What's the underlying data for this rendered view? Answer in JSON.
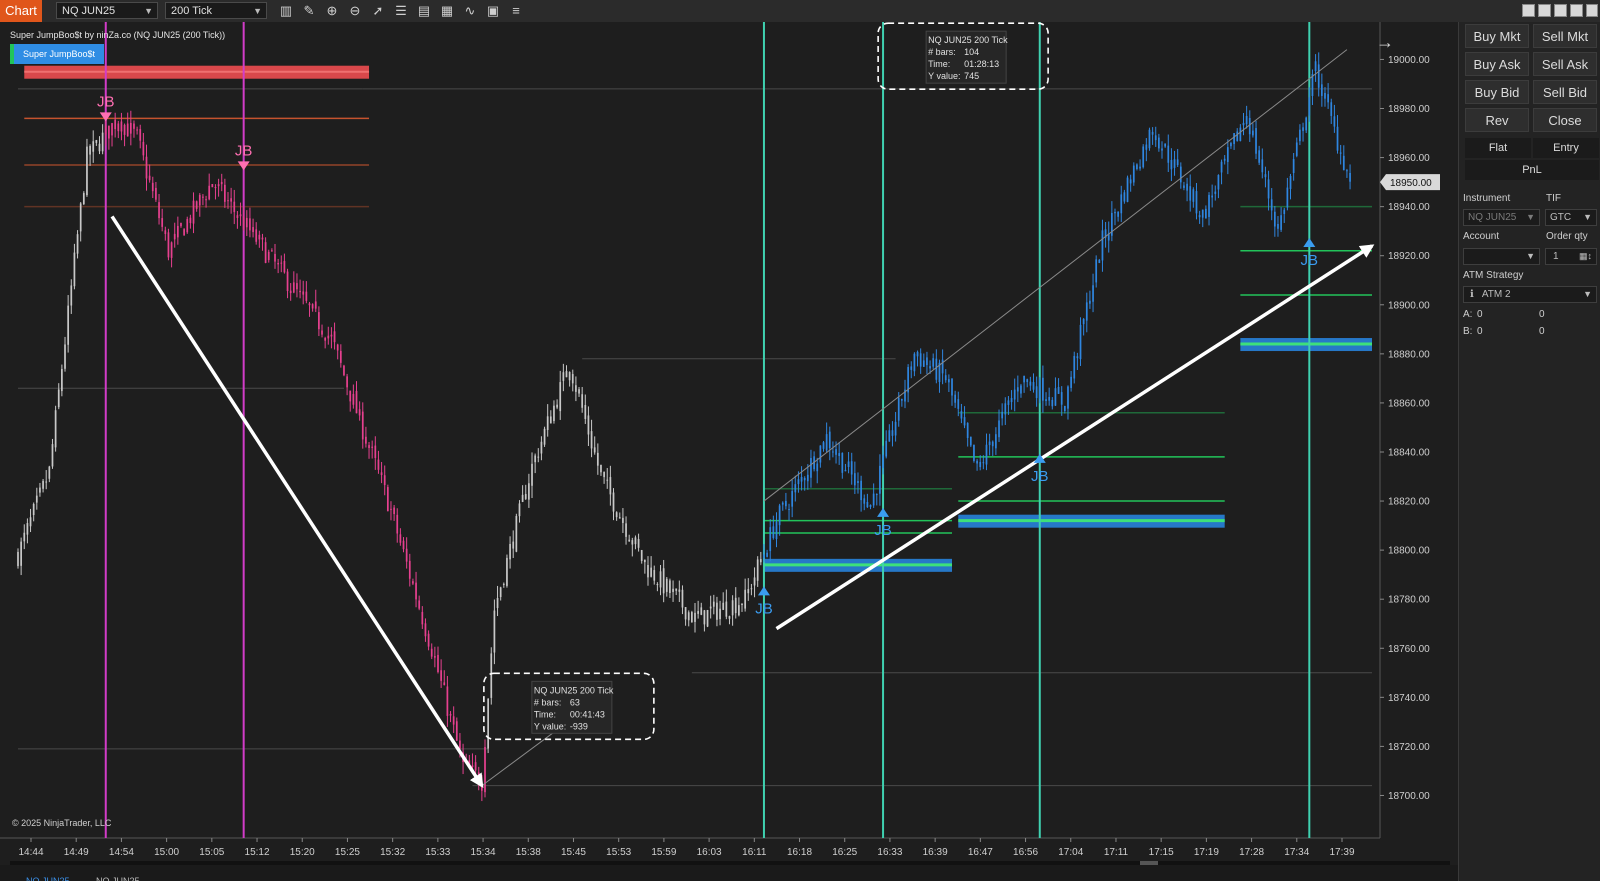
{
  "toolbar": {
    "chart_label": "Chart",
    "instrument": "NQ JUN25",
    "interval": "200 Tick",
    "icons": [
      "bar-type-icon",
      "pencil-icon",
      "zoom-in-icon",
      "zoom-out-icon",
      "pointer-icon",
      "properties-icon",
      "data-box-icon",
      "strategies-icon",
      "indicators-icon",
      "templates-icon",
      "list-icon"
    ]
  },
  "legend": {
    "title": "Super JumpBoo$t by ninZa.co (NQ JUN25 (200 Tick))",
    "button": "Super JumpBoo$t"
  },
  "copyright": "© 2025 NinjaTrader, LLC",
  "last_price_label": "18950.00",
  "chart_data": {
    "type": "candlestick",
    "ylim": [
      18690,
      19012
    ],
    "y_ticks": [
      18700,
      18720,
      18740,
      18760,
      18780,
      18800,
      18820,
      18840,
      18860,
      18880,
      18900,
      18920,
      18940,
      18960,
      18980,
      19000
    ],
    "x_ticks": [
      "14:44",
      "14:49",
      "14:54",
      "15:00",
      "15:05",
      "15:12",
      "15:20",
      "15:25",
      "15:32",
      "15:33",
      "15:34",
      "15:38",
      "15:45",
      "15:53",
      "15:59",
      "16:03",
      "16:11",
      "16:18",
      "16:25",
      "16:33",
      "16:39",
      "16:47",
      "16:56",
      "17:04",
      "17:11",
      "17:15",
      "17:19",
      "17:28",
      "17:34",
      "17:39"
    ],
    "price_path": [
      {
        "bar": 0,
        "price": 18798
      },
      {
        "bar": 10,
        "price": 18832
      },
      {
        "bar": 22,
        "price": 18960
      },
      {
        "bar": 32,
        "price": 18976
      },
      {
        "bar": 38,
        "price": 18968
      },
      {
        "bar": 48,
        "price": 18922
      },
      {
        "bar": 62,
        "price": 18950
      },
      {
        "bar": 74,
        "price": 18930
      },
      {
        "bar": 100,
        "price": 18886
      },
      {
        "bar": 118,
        "price": 18820
      },
      {
        "bar": 132,
        "price": 18760
      },
      {
        "bar": 142,
        "price": 18712
      },
      {
        "bar": 148,
        "price": 18706
      },
      {
        "bar": 152,
        "price": 18776
      },
      {
        "bar": 164,
        "price": 18834
      },
      {
        "bar": 176,
        "price": 18876
      },
      {
        "bar": 186,
        "price": 18830
      },
      {
        "bar": 200,
        "price": 18794
      },
      {
        "bar": 216,
        "price": 18772
      },
      {
        "bar": 232,
        "price": 18780
      },
      {
        "bar": 242,
        "price": 18812
      },
      {
        "bar": 258,
        "price": 18846
      },
      {
        "bar": 272,
        "price": 18818
      },
      {
        "bar": 286,
        "price": 18880
      },
      {
        "bar": 296,
        "price": 18870
      },
      {
        "bar": 306,
        "price": 18832
      },
      {
        "bar": 320,
        "price": 18870
      },
      {
        "bar": 334,
        "price": 18860
      },
      {
        "bar": 346,
        "price": 18926
      },
      {
        "bar": 362,
        "price": 18972
      },
      {
        "bar": 378,
        "price": 18936
      },
      {
        "bar": 392,
        "price": 18978
      },
      {
        "bar": 402,
        "price": 18930
      },
      {
        "bar": 414,
        "price": 18996
      },
      {
        "bar": 425,
        "price": 18950
      }
    ],
    "segments": [
      {
        "from_bar": 0,
        "to_bar": 28,
        "color": "white"
      },
      {
        "from_bar": 28,
        "to_bar": 150,
        "color": "pink"
      },
      {
        "from_bar": 150,
        "to_bar": 238,
        "color": "white"
      },
      {
        "from_bar": 238,
        "to_bar": 425,
        "color": "blue"
      }
    ],
    "jb_signals": [
      {
        "bar": 28,
        "price": 18976,
        "direction": "down",
        "label": "JB"
      },
      {
        "bar": 72,
        "price": 18956,
        "direction": "down",
        "label": "JB"
      },
      {
        "bar": 238,
        "price": 18784,
        "direction": "up",
        "label": "JB"
      },
      {
        "bar": 276,
        "price": 18816,
        "direction": "up",
        "label": "JB"
      },
      {
        "bar": 326,
        "price": 18838,
        "direction": "up",
        "label": "JB"
      },
      {
        "bar": 412,
        "price": 18926,
        "direction": "up",
        "label": "JB"
      }
    ],
    "signal_verticals": [
      {
        "bar": 28,
        "color": "magenta"
      },
      {
        "bar": 72,
        "color": "magenta"
      },
      {
        "bar": 238,
        "color": "teal"
      },
      {
        "bar": 276,
        "color": "teal"
      },
      {
        "bar": 326,
        "color": "teal"
      },
      {
        "bar": 412,
        "color": "teal"
      }
    ],
    "zones": [
      {
        "from_bar": 2,
        "to_bar": 112,
        "price": 18995,
        "style": "red-band"
      },
      {
        "from_bar": 2,
        "to_bar": 112,
        "price": 18976,
        "style": "orange-line"
      },
      {
        "from_bar": 2,
        "to_bar": 112,
        "price": 18957,
        "style": "orange-line-dim"
      },
      {
        "from_bar": 2,
        "to_bar": 112,
        "price": 18940,
        "style": "orange-line-faint"
      },
      {
        "from_bar": 238,
        "to_bar": 298,
        "price": 18794,
        "style": "blue-green-band"
      },
      {
        "from_bar": 238,
        "to_bar": 298,
        "price": 18807,
        "style": "green-line"
      },
      {
        "from_bar": 238,
        "to_bar": 298,
        "price": 18812,
        "style": "green-line"
      },
      {
        "from_bar": 238,
        "to_bar": 298,
        "price": 18825,
        "style": "green-line-faint"
      },
      {
        "from_bar": 300,
        "to_bar": 385,
        "price": 18812,
        "style": "blue-green-band"
      },
      {
        "from_bar": 300,
        "to_bar": 385,
        "price": 18820,
        "style": "green-line"
      },
      {
        "from_bar": 300,
        "to_bar": 385,
        "price": 18838,
        "style": "green-line"
      },
      {
        "from_bar": 300,
        "to_bar": 385,
        "price": 18856,
        "style": "green-line-faint"
      },
      {
        "from_bar": 390,
        "to_bar": 432,
        "price": 18884,
        "style": "blue-green-band"
      },
      {
        "from_bar": 390,
        "to_bar": 432,
        "price": 18904,
        "style": "green-line"
      },
      {
        "from_bar": 390,
        "to_bar": 432,
        "price": 18922,
        "style": "green-line"
      },
      {
        "from_bar": 390,
        "to_bar": 432,
        "price": 18940,
        "style": "green-line-faint"
      }
    ],
    "gray_levels": [
      {
        "from_bar": 0,
        "to_bar": 110,
        "price": 18988
      },
      {
        "from_bar": 0,
        "to_bar": 104,
        "price": 18866
      },
      {
        "from_bar": 180,
        "to_bar": 280,
        "price": 18878
      },
      {
        "from_bar": 215,
        "to_bar": 432,
        "price": 18750
      },
      {
        "from_bar": 0,
        "to_bar": 150,
        "price": 18719
      },
      {
        "from_bar": 145,
        "to_bar": 432,
        "price": 18704
      },
      {
        "from_bar": 110,
        "to_bar": 432,
        "price": 18988
      }
    ],
    "trend_arrows": [
      {
        "from_bar": 30,
        "from_price": 18936,
        "to_bar": 148,
        "to_price": 18704
      },
      {
        "from_bar": 242,
        "from_price": 18768,
        "to_bar": 432,
        "to_price": 18924
      }
    ],
    "measure_lines": [
      {
        "from_bar": 148,
        "from_price": 18704,
        "to_bar": 186,
        "to_price": 18740
      },
      {
        "from_bar": 238,
        "from_price": 18820,
        "to_bar": 424,
        "to_price": 19004
      }
    ],
    "measure_boxes": [
      {
        "title": "NQ JUN25 200 Tick",
        "bars_label": "# bars:",
        "bars": "63",
        "time_label": "Time:",
        "time": "00:41:43",
        "yval_label": "Y value:",
        "yval": "-939",
        "anchor_bar": 148,
        "anchor_price": 18740
      },
      {
        "title": "NQ JUN25 200 Tick",
        "bars_label": "# bars:",
        "bars": "104",
        "time_label": "Time:",
        "time": "01:28:13",
        "yval_label": "Y value:",
        "yval": "745",
        "anchor_bar": 284,
        "anchor_price": 19005
      }
    ],
    "colors": {
      "white": "#c8c8c8",
      "pink": "#e6408f",
      "blue": "#2f86e0",
      "teal": "#3fd1b0",
      "magenta": "#d23cc8",
      "green": "#22c45a",
      "band_blue": "#2678c8",
      "red": "#d9484b",
      "orange": "#c6532e",
      "gray": "#4a4a4a"
    }
  },
  "panel": {
    "buttons": [
      "Buy Mkt",
      "Sell Mkt",
      "Buy Ask",
      "Sell Ask",
      "Buy Bid",
      "Sell Bid",
      "Rev",
      "Close"
    ],
    "tabs": [
      "Flat",
      "Entry"
    ],
    "pnl": "PnL",
    "instrument_label": "Instrument",
    "instrument_value": "NQ JUN25",
    "tif_label": "TIF",
    "tif_value": "GTC",
    "account_label": "Account",
    "account_value": "",
    "qty_label": "Order qty",
    "qty_value": "1",
    "atm_label": "ATM Strategy",
    "atm_value": "ATM 2",
    "a_label": "A:",
    "a_val1": "0",
    "a_val2": "0",
    "b_label": "B:",
    "b_val1": "0",
    "b_val2": "0"
  },
  "tabs_bottom": [
    "NQ JUN25",
    "NQ JUN25 ..."
  ]
}
